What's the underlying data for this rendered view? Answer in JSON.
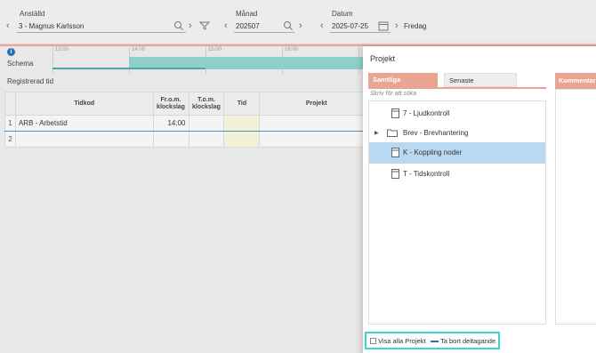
{
  "filters": {
    "employee": {
      "label": "Anställd",
      "value": "3 - Magnus Karlsson"
    },
    "month": {
      "label": "Månad",
      "value": "202507"
    },
    "date": {
      "label": "Datum",
      "value": "2025-07-25",
      "weekday": "Fredag"
    }
  },
  "timeline": {
    "ticks": [
      "13:00",
      "14:00",
      "15:00",
      "16:00"
    ],
    "schema_label": "Schema",
    "registered_label": "Registrerad tid"
  },
  "table": {
    "headers": [
      "Tidkod",
      "Fr.o.m. klockslag",
      "T.o.m. klockslag",
      "Tid",
      "Projekt"
    ],
    "rows": [
      {
        "num": "1",
        "tidkod": "ARB - Arbetstid",
        "from": "14:00",
        "to": "",
        "tid": "",
        "projekt": ""
      },
      {
        "num": "2",
        "tidkod": "",
        "from": "",
        "to": "",
        "tid": "",
        "projekt": ""
      }
    ]
  },
  "modal": {
    "title": "Projekt",
    "tabs": [
      "Samtliga",
      "Senaste"
    ],
    "search_placeholder": "Skriv för att söka",
    "items": [
      {
        "label": "7 - Ljudkontroll",
        "icon": "document-icon"
      },
      {
        "label": "Brev - Brevhantering",
        "icon": "folder-icon"
      },
      {
        "label": "K - Koppling noder",
        "icon": "document-icon",
        "selected": true
      },
      {
        "label": "T - Tidskontroll",
        "icon": "document-icon"
      }
    ],
    "comment_tab": "Kommentar",
    "show_all_label": "Visa alla Projekt",
    "remove_label": "Ta bort deltagande"
  },
  "colors": {
    "accent": "#e9a590",
    "selection": "#b9d9f2",
    "schema": "#8fcfca",
    "highlight_border": "#3cd6c8"
  }
}
